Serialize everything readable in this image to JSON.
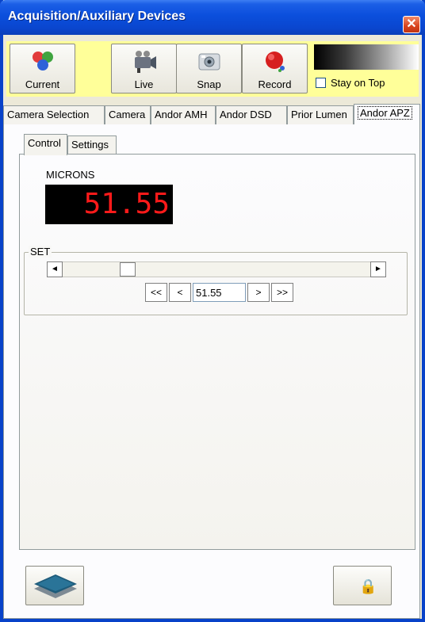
{
  "window": {
    "title": "Acquisition/Auxiliary Devices",
    "close_symbol": "✕"
  },
  "toolbar": {
    "buttons": [
      {
        "label": "Current",
        "icon": "rgb-circles-icon"
      },
      {
        "label": "Live",
        "icon": "video-camera-icon"
      },
      {
        "label": "Snap",
        "icon": "camera-icon"
      },
      {
        "label": "Record",
        "icon": "record-icon"
      }
    ],
    "stay_on_top_label": "Stay on Top",
    "stay_on_top_checked": false
  },
  "tabs": [
    "Camera Selection",
    "Camera",
    "Andor AMH",
    "Andor DSD",
    "Prior Lumen",
    "Andor APZ"
  ],
  "active_tab": "Andor APZ",
  "inner_tabs": [
    "Control",
    "Settings"
  ],
  "active_inner_tab": "Control",
  "control": {
    "microns_label": "MICRONS",
    "readout_value": "51.55",
    "set_label": "SET",
    "set_value": "51.55",
    "nav": {
      "first": "<<",
      "prev": "<",
      "next": ">",
      "last": ">>"
    },
    "scroll_left_arrow": "◄",
    "scroll_right_arrow": "►"
  },
  "bottom": {
    "left_icon": "layers-logo-icon",
    "right_icon": "lock-icon",
    "lock_symbol": "🔒"
  },
  "colors": {
    "titlebar": "#0a46cf",
    "toolbar_bg": "#ffff99",
    "readout_bg": "#000000",
    "readout_text": "#ff1a1a"
  }
}
